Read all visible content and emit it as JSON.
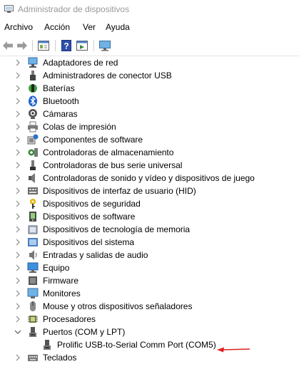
{
  "window": {
    "title": "Administrador de dispositivos"
  },
  "menu": {
    "items": [
      "Archivo",
      "Acción",
      "Ver",
      "Ayuda"
    ]
  },
  "toolbar": {
    "buttons": [
      "back-arrow-icon",
      "forward-arrow-icon",
      "properties-icon",
      "help-icon",
      "scan-icon",
      "monitor-icon"
    ]
  },
  "tree": {
    "categories": [
      {
        "label": "Adaptadores de red",
        "icon": "network-adapter-icon",
        "expanded": false
      },
      {
        "label": "Administradores de conector USB",
        "icon": "usb-connector-icon",
        "expanded": false
      },
      {
        "label": "Baterías",
        "icon": "battery-icon",
        "expanded": false
      },
      {
        "label": "Bluetooth",
        "icon": "bluetooth-icon",
        "expanded": false
      },
      {
        "label": "Cámaras",
        "icon": "camera-icon",
        "expanded": false
      },
      {
        "label": "Colas de impresión",
        "icon": "printer-icon",
        "expanded": false
      },
      {
        "label": "Componentes de software",
        "icon": "software-component-icon",
        "expanded": false
      },
      {
        "label": "Controladoras de almacenamiento",
        "icon": "storage-controller-icon",
        "expanded": false
      },
      {
        "label": "Controladoras de bus serie universal",
        "icon": "usb-controller-icon",
        "expanded": false
      },
      {
        "label": "Controladoras de sonido y vídeo y dispositivos de juego",
        "icon": "speaker-icon",
        "expanded": false
      },
      {
        "label": "Dispositivos de interfaz de usuario (HID)",
        "icon": "hid-icon",
        "expanded": false
      },
      {
        "label": "Dispositivos de seguridad",
        "icon": "security-key-icon",
        "expanded": false
      },
      {
        "label": "Dispositivos de software",
        "icon": "software-device-icon",
        "expanded": false
      },
      {
        "label": "Dispositivos de tecnología de memoria",
        "icon": "memory-icon",
        "expanded": false
      },
      {
        "label": "Dispositivos del sistema",
        "icon": "system-device-icon",
        "expanded": false
      },
      {
        "label": "Entradas y salidas de audio",
        "icon": "audio-io-icon",
        "expanded": false
      },
      {
        "label": "Equipo",
        "icon": "computer-icon",
        "expanded": false
      },
      {
        "label": "Firmware",
        "icon": "firmware-icon",
        "expanded": false
      },
      {
        "label": "Monitores",
        "icon": "monitor-icon",
        "expanded": false
      },
      {
        "label": "Mouse y otros dispositivos señaladores",
        "icon": "mouse-icon",
        "expanded": false
      },
      {
        "label": "Procesadores",
        "icon": "processor-icon",
        "expanded": false
      },
      {
        "label": "Puertos (COM y LPT)",
        "icon": "port-icon",
        "expanded": true,
        "children": [
          {
            "label": "Prolific USB-to-Serial Comm Port (COM5)",
            "icon": "port-icon"
          }
        ]
      },
      {
        "label": "Teclados",
        "icon": "keyboard-icon",
        "expanded": false
      }
    ]
  },
  "annotation": {
    "color": "#e02020"
  }
}
